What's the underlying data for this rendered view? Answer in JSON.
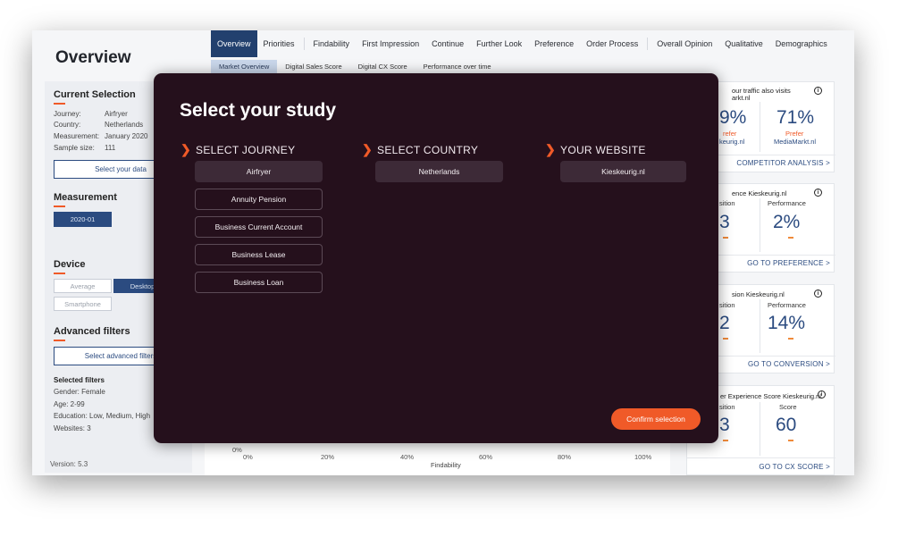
{
  "header": {
    "title": "Overview"
  },
  "nav": {
    "tabs": [
      "Overview",
      "Priorities",
      "Findability",
      "First Impression",
      "Continue",
      "Further Look",
      "Preference",
      "Order Process",
      "Overall Opinion",
      "Qualitative",
      "Demographics"
    ],
    "subtabs": [
      "Market Overview",
      "Digital Sales Score",
      "Digital CX Score",
      "Performance over time"
    ]
  },
  "sidebar": {
    "current_selection": "Current Selection",
    "journey_label": "Journey:",
    "journey_value": "Airfryer",
    "country_label": "Country:",
    "country_value": "Netherlands",
    "measurement_label": "Measurement:",
    "measurement_value": "January 2020",
    "sample_label": "Sample size:",
    "sample_value": "111",
    "select_data": "Select your data",
    "measurement_title": "Measurement",
    "measurement_pill": "2020-01",
    "device_title": "Device",
    "device_average": "Average",
    "device_desktop": "Desktop",
    "device_smartphone": "Smartphone",
    "advanced_title": "Advanced filters",
    "advanced_btn": "Select advanced filters",
    "selected_filters": "Selected filters",
    "f_gender": "Gender: Female",
    "f_age": "Age: 2-99",
    "f_edu": "Education: Low, Medium, High",
    "f_web": "Websites: 3",
    "version": "Version: 5.3"
  },
  "chart": {
    "y0": "0%",
    "ticks": [
      "0%",
      "20%",
      "40%",
      "60%",
      "80%",
      "100%"
    ],
    "xlabel": "Findability"
  },
  "cards": {
    "c1": {
      "title1": "our traffic also visits",
      "title2": "arkt.nl",
      "left_big": "9%",
      "left_small": "refer",
      "left_name": "keurig.nl",
      "right_big": "71%",
      "right_small": "Prefer",
      "right_name": "MediaMarkt.nl",
      "link": "COMPETITOR ANALYSIS >"
    },
    "c2": {
      "title": "ence Kieskeurig.nl",
      "h_left": "sition",
      "h_right": "Performance",
      "big_left": "3",
      "big_right": "2%",
      "link": "GO TO PREFERENCE >"
    },
    "c3": {
      "title": "sion Kieskeurig.nl",
      "h_left": "sition",
      "h_right": "Performance",
      "big_left": "2",
      "big_right": "14%",
      "link": "GO TO CONVERSION >"
    },
    "c4": {
      "title": "er Experience Score Kieskeurig.nl",
      "h_left": "sition",
      "h_right": "Score",
      "big_left": "3",
      "big_right": "60",
      "link": "GO TO CX SCORE >"
    },
    "info_glyph": "i"
  },
  "modal": {
    "title": "Select your study",
    "journey_header": "SELECT JOURNEY",
    "country_header": "SELECT COUNTRY",
    "website_header": "YOUR WEBSITE",
    "journeys": [
      "Airfryer",
      "Annuity Pension",
      "Business Current Account",
      "Business Lease",
      "Business Loan"
    ],
    "country": "Netherlands",
    "website": "Kieskeurig.nl",
    "confirm": "Confirm selection"
  },
  "colors": {
    "accent": "#f05a28",
    "modal_bg": "#25101c",
    "primary": "#22406e"
  }
}
